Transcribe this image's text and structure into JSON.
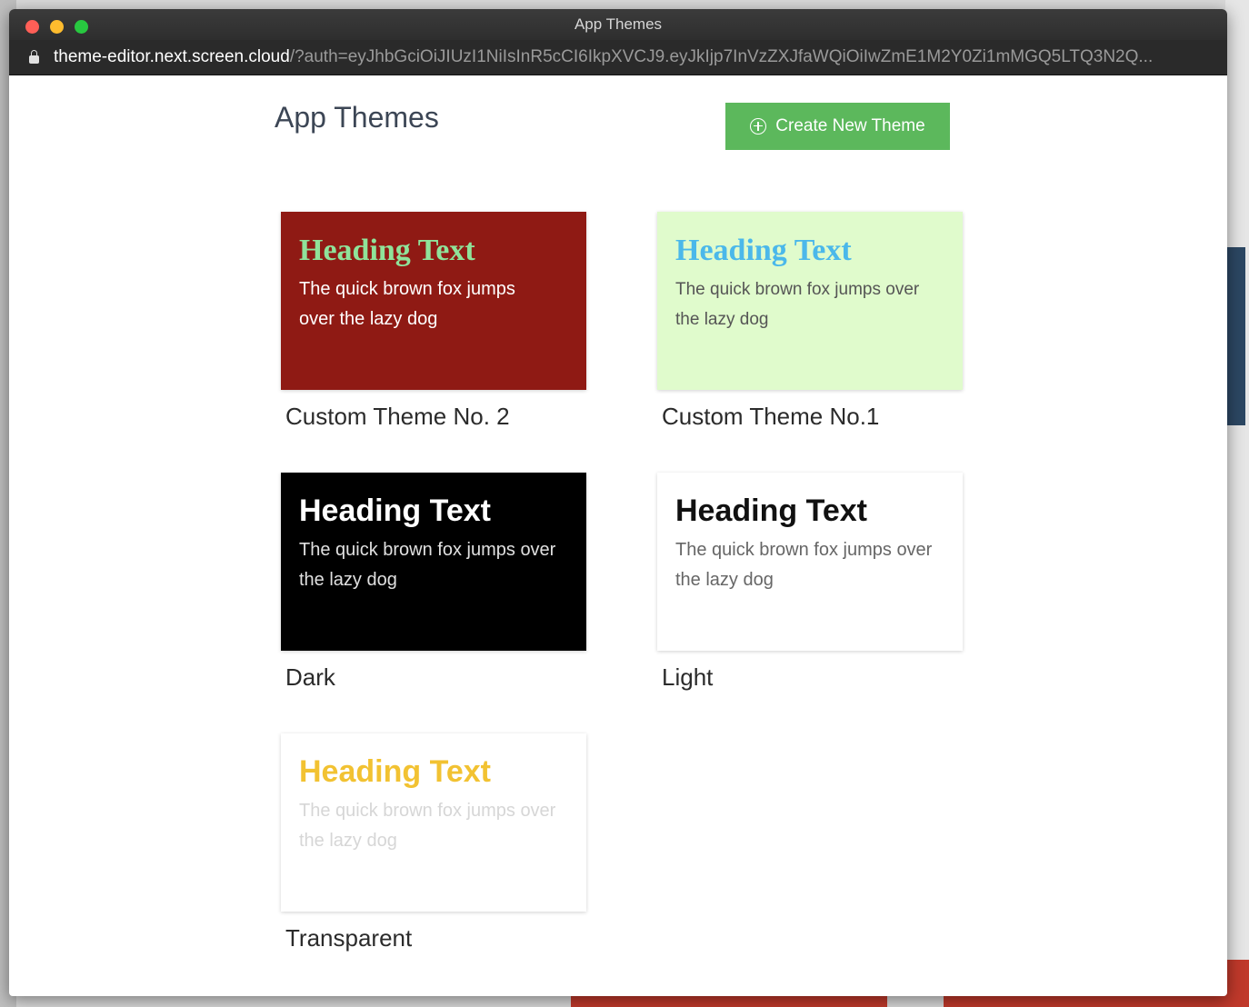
{
  "window": {
    "title": "App Themes",
    "url_host": "theme-editor.next.screen.cloud",
    "url_rest": "/?auth=eyJhbGciOiJIUzI1NiIsInR5cCI6IkpXVCJ9.eyJkIjp7InVzZXJfaWQiOiIwZmE1M2Y0Zi1mMGQ5LTQ3N2Q..."
  },
  "page": {
    "title": "App Themes",
    "create_button_label": "Create New Theme"
  },
  "themes": [
    {
      "name": "Custom Theme No. 2",
      "heading": "Heading Text",
      "body": "The quick brown fox jumps over the lazy dog",
      "background": "#8f1a14",
      "heading_color": "#8fe39a",
      "body_color": "#ffffff"
    },
    {
      "name": "Custom Theme No.1",
      "heading": "Heading Text",
      "body": "The quick brown fox jumps over the lazy dog",
      "background": "#e0fbcc",
      "heading_color": "#4bb8ea",
      "body_color": "#555555"
    },
    {
      "name": "Dark",
      "heading": "Heading Text",
      "body": "The quick brown fox jumps over the lazy dog",
      "background": "#000000",
      "heading_color": "#ffffff",
      "body_color": "#e0e0e0"
    },
    {
      "name": "Light",
      "heading": "Heading Text",
      "body": "The quick brown fox jumps over the lazy dog",
      "background": "#ffffff",
      "heading_color": "#111111",
      "body_color": "#666666"
    },
    {
      "name": "Transparent",
      "heading": "Heading Text",
      "body": "The quick brown fox jumps over the lazy dog",
      "background": "#ffffff",
      "heading_color": "#f2c232",
      "body_color": "#d6d6d6"
    }
  ]
}
